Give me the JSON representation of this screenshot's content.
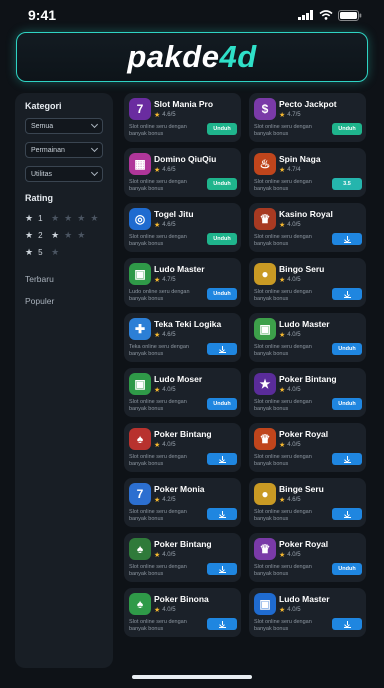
{
  "status": {
    "time": "9:41"
  },
  "header": {
    "logo_part1": "pakde",
    "logo_part2": "4d"
  },
  "sidebar": {
    "category_title": "Kategori",
    "selects": [
      "Semua",
      "Permainan",
      "Utilitas"
    ],
    "rating_title": "Rating",
    "ratings": [
      "1",
      "2",
      "5"
    ],
    "links": [
      "Terbaru",
      "Populer"
    ]
  },
  "apps": [
    {
      "title": "Slot Mania Pro",
      "rating": "4.6/5",
      "desc": "Slot online seru dengan banyak bonus",
      "button": "Unduh",
      "button_style": "green",
      "icon": "slot-icon",
      "icon_bg": "#6a2ca0"
    },
    {
      "title": "Pecto Jackpot",
      "rating": "4.7/5",
      "desc": "Slot online seru dengan banyak bonus",
      "button": "Unduh",
      "button_style": "green",
      "icon": "jackpot-icon",
      "icon_bg": "#7a3aa8"
    },
    {
      "title": "Domino QiuQiu",
      "rating": "4.6/5",
      "desc": "Slot online seru dengan banyak bonus",
      "button": "Unduh",
      "button_style": "green",
      "icon": "domino-icon",
      "icon_bg": "#b0369a"
    },
    {
      "title": "Spin Naga",
      "rating": "4.7/4",
      "desc": "Slot online seru dengan banyak bonus",
      "button": "3.5",
      "button_style": "teal",
      "icon": "dragon-icon",
      "icon_bg": "#c0451c"
    },
    {
      "title": "Togel Jitu",
      "rating": "4.6/5",
      "desc": "Slot online seru dengan banyak bonus",
      "button": "Unduh",
      "button_style": "green",
      "icon": "lottery-icon",
      "icon_bg": "#1f6bd0"
    },
    {
      "title": "Kasino Royal",
      "rating": "4.0/5",
      "desc": "Slot online seru dengan banyak bonus",
      "button": "",
      "button_style": "blue",
      "icon": "crown-icon",
      "icon_bg": "#a83a22"
    },
    {
      "title": "Ludo Master",
      "rating": "4.7/5",
      "desc": "Ludo online seru dengan banyak bonus",
      "button": "Unduh",
      "button_style": "blue",
      "icon": "ludo-icon",
      "icon_bg": "#2f9a48"
    },
    {
      "title": "Bingo Seru",
      "rating": "4.0/5",
      "desc": "Slot online seru dengan banyak bonus",
      "button": "",
      "button_style": "blue",
      "icon": "bingo-icon",
      "icon_bg": "#c99a24"
    },
    {
      "title": "Teka Teki Logika",
      "rating": "4.6/5",
      "desc": "Teka online seru dengan banyak bonus",
      "button": "",
      "button_style": "blue",
      "icon": "puzzle-icon",
      "icon_bg": "#2c7fd6"
    },
    {
      "title": "Ludo Master",
      "rating": "4.0/5",
      "desc": "Slot online seru dengan banyak bonus",
      "button": "Unduh",
      "button_style": "blue",
      "icon": "ludo-icon",
      "icon_bg": "#3da04a"
    },
    {
      "title": "Ludo Moser",
      "rating": "4.0/5",
      "desc": "Slot online seru dengan banyak bonus",
      "button": "Unduh",
      "button_style": "blue",
      "icon": "ludo-icon",
      "icon_bg": "#2f9a48"
    },
    {
      "title": "Poker Bintang",
      "rating": "4.0/5",
      "desc": "Slot online seru dengan banyak bonus",
      "button": "Unduh",
      "button_style": "blue",
      "icon": "star-badge-icon",
      "icon_bg": "#5a2c9a"
    },
    {
      "title": "Poker Bintang",
      "rating": "4.0/5",
      "desc": "Slot online seru dengan banyak bonus",
      "button": "",
      "button_style": "blue",
      "icon": "cards-icon",
      "icon_bg": "#b8322e"
    },
    {
      "title": "Poker Royal",
      "rating": "4.0/5",
      "desc": "Slot online seru dengan banyak bonus",
      "button": "",
      "button_style": "blue",
      "icon": "crown-icon",
      "icon_bg": "#c0451c"
    },
    {
      "title": "Poker Monia",
      "rating": "4.2/5",
      "desc": "Slot online seru dengan banyak bonus",
      "button": "",
      "button_style": "blue",
      "icon": "slot-icon",
      "icon_bg": "#2c6fd0"
    },
    {
      "title": "Binge Seru",
      "rating": "4.6/5",
      "desc": "Slot online seru dengan banyak bonus",
      "button": "",
      "button_style": "blue",
      "icon": "bingo-icon",
      "icon_bg": "#c99a24"
    },
    {
      "title": "Poker Bintang",
      "rating": "4.0/5",
      "desc": "Slot online seru dengan banyak bonus",
      "button": "",
      "button_style": "blue",
      "icon": "cards-icon",
      "icon_bg": "#2f7a3a"
    },
    {
      "title": "Poker Royal",
      "rating": "4.0/5",
      "desc": "Slot online seru dengan banyak bonus",
      "button": "Unduh",
      "button_style": "blue",
      "icon": "crown-icon",
      "icon_bg": "#7a3aa8"
    },
    {
      "title": "Poker Binona",
      "rating": "4.0/5",
      "desc": "Slot online seru dengan banyak bonus",
      "button": "",
      "button_style": "blue",
      "icon": "cards-icon",
      "icon_bg": "#2f9a48"
    },
    {
      "title": "Ludo Master",
      "rating": "4.0/5",
      "desc": "Slot online seru dengan banyak bonus",
      "button": "",
      "button_style": "blue",
      "icon": "ludo-icon",
      "icon_bg": "#1f6bd0"
    }
  ]
}
